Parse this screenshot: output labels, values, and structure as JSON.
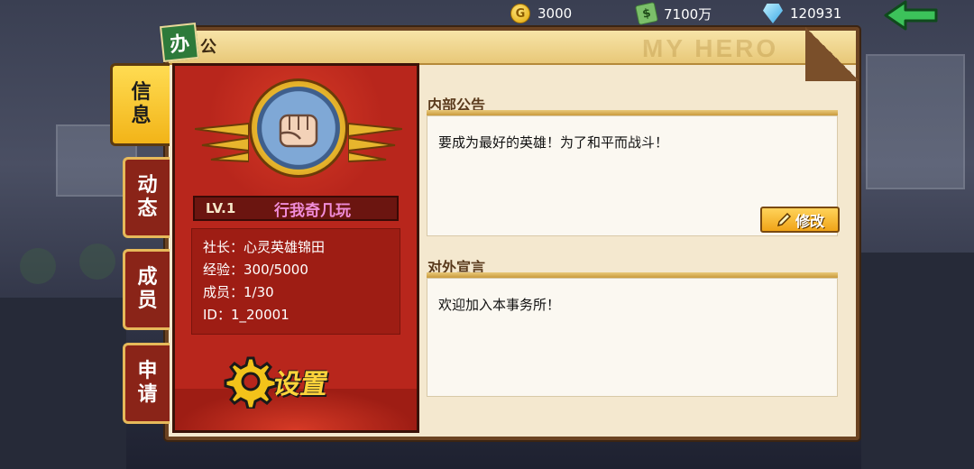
{
  "resources": {
    "gold": "3000",
    "cash": "7100万",
    "gems": "120931",
    "gold_icon_glyph": "G"
  },
  "header": {
    "badge": "办",
    "title": "公",
    "watermark": "MY HERO"
  },
  "tabs": [
    {
      "label_top": "信",
      "label_bottom": "息",
      "active": true
    },
    {
      "label_top": "动",
      "label_bottom": "态",
      "active": false
    },
    {
      "label_top": "成",
      "label_bottom": "员",
      "active": false
    },
    {
      "label_top": "申",
      "label_bottom": "请",
      "active": false
    }
  ],
  "profile": {
    "level": "LV.1",
    "guild_name": "行我奇几玩",
    "leader": "社长：心灵英雄锦田",
    "exp": "经验：300/5000",
    "members": "成员：1/30",
    "id": "ID：1_20001",
    "settings_label": "设置"
  },
  "notice": {
    "title": "内部公告",
    "text": "要成为最好的英雄！为了和平而战斗！",
    "edit_label": "修改"
  },
  "declaration": {
    "title": "对外宣言",
    "text": "欢迎加入本事务所！"
  },
  "colors": {
    "panel_red": "#b8261c",
    "active_tab_yellow": "#f2b418",
    "guild_name_pink": "#f08cd8",
    "settings_yellow": "#ffd43b",
    "frame_bg": "#f4e8cf"
  }
}
